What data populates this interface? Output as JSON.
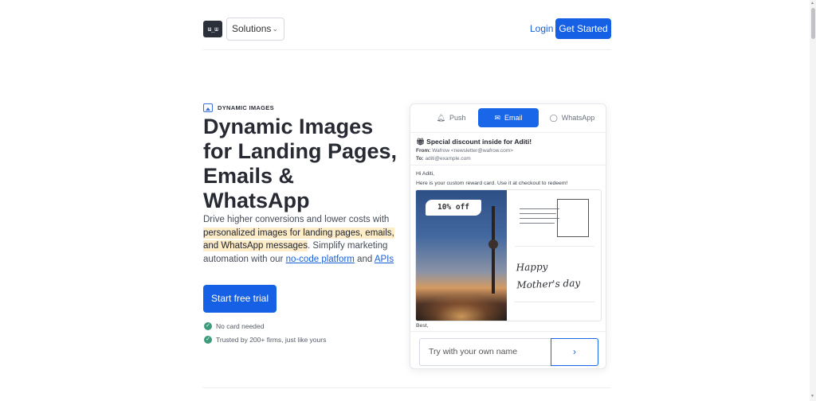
{
  "header": {
    "logo_text": "ɯ_ɯ",
    "solutions_label": "Solutions",
    "login_label": "Login",
    "get_started_label": "Get Started"
  },
  "hero": {
    "eyebrow": "DYNAMIC IMAGES",
    "headline": "Dynamic Images for Landing Pages, Emails & WhatsApp",
    "sub_part1": "Drive higher conversions and lower costs with ",
    "sub_highlight": "personalized images for landing pages, emails, and WhatsApp messages",
    "sub_part2": ". Simplify marketing automation with our ",
    "sub_link1": "no-code platform",
    "sub_part3": " and ",
    "sub_link2": "APIs",
    "cta_label": "Start free trial",
    "checks": [
      "No card needed",
      "Trusted by 200+ firms, just like yours"
    ]
  },
  "demo": {
    "tabs": [
      {
        "label": "Push",
        "icon": "bell-icon"
      },
      {
        "label": "Email",
        "icon": "mail-icon"
      },
      {
        "label": "WhatsApp",
        "icon": "whatsapp-icon"
      }
    ],
    "active_tab": "Email",
    "email": {
      "subject": "Special discount inside for Aditi!",
      "from_label": "From:",
      "from_value": "Wafrow <newsletter@wafrow.com>",
      "to_label": "To:",
      "to_value": "aditi@example.com",
      "greeting": "Hi Aditi,",
      "body": "Here is your custom reward card. Use it at checkout to redeem!",
      "badge": "10% off",
      "card_message_line1": "Happy",
      "card_message_line2": "Mother's day",
      "sign_off": "Best,"
    },
    "name_input_placeholder": "Try with your own name",
    "go_symbol": "›"
  },
  "colors": {
    "accent": "#1560e5",
    "highlight": "#fdecc8",
    "check_green": "#3d9b7c"
  }
}
